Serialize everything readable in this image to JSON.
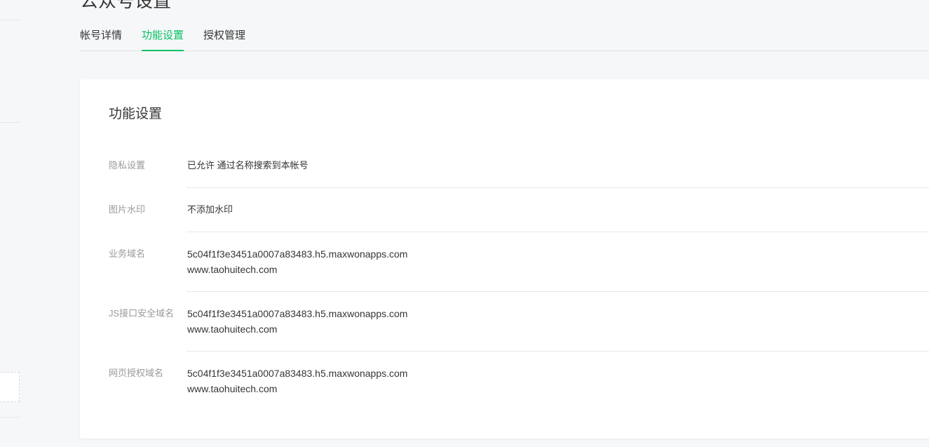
{
  "page": {
    "title": "公众号设置"
  },
  "tabs": [
    {
      "label": "帐号详情",
      "active": false
    },
    {
      "label": "功能设置",
      "active": true
    },
    {
      "label": "授权管理",
      "active": false
    }
  ],
  "card": {
    "title": "功能设置",
    "rows": [
      {
        "label": "隐私设置",
        "values": [
          "已允许 通过名称搜索到本帐号"
        ]
      },
      {
        "label": "图片水印",
        "values": [
          "不添加水印"
        ]
      },
      {
        "label": "业务域名",
        "values": [
          "5c04f1f3e3451a0007a83483.h5.maxwonapps.com",
          "www.taohuitech.com"
        ]
      },
      {
        "label": "JS接口安全域名",
        "values": [
          "5c04f1f3e3451a0007a83483.h5.maxwonapps.com",
          "www.taohuitech.com"
        ]
      },
      {
        "label": "网页授权域名",
        "values": [
          "5c04f1f3e3451a0007a83483.h5.maxwonapps.com",
          "www.taohuitech.com"
        ]
      }
    ]
  },
  "colors": {
    "accent": "#07c160",
    "background": "#f6f7f9",
    "label": "#9a9a9a",
    "text": "#353535",
    "divider": "#e4e8eb"
  }
}
